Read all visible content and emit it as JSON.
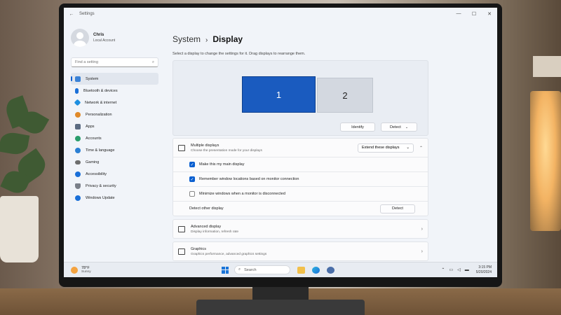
{
  "window": {
    "title": "Settings"
  },
  "user": {
    "name": "Chris",
    "account": "Local Account"
  },
  "search": {
    "placeholder": "Find a setting"
  },
  "sidebar": {
    "items": [
      {
        "label": "System",
        "icon": "monitor-icon",
        "color": "#3b82d6",
        "active": true
      },
      {
        "label": "Bluetooth & devices",
        "icon": "bluetooth-icon",
        "color": "#1a6fd8"
      },
      {
        "label": "Network & internet",
        "icon": "wifi-icon",
        "color": "#1d8fe0"
      },
      {
        "label": "Personalization",
        "icon": "brush-icon",
        "color": "#e08a2a"
      },
      {
        "label": "Apps",
        "icon": "apps-icon",
        "color": "#5b6b82"
      },
      {
        "label": "Accounts",
        "icon": "person-icon",
        "color": "#2a9d6c"
      },
      {
        "label": "Time & language",
        "icon": "globe-icon",
        "color": "#2b7fd3"
      },
      {
        "label": "Gaming",
        "icon": "controller-icon",
        "color": "#6d6d6d"
      },
      {
        "label": "Accessibility",
        "icon": "accessibility-icon",
        "color": "#1a6fd8"
      },
      {
        "label": "Privacy & security",
        "icon": "shield-icon",
        "color": "#7a7f88"
      },
      {
        "label": "Windows Update",
        "icon": "update-icon",
        "color": "#1a6fd8"
      }
    ]
  },
  "main": {
    "breadcrumb_parent": "System",
    "breadcrumb_current": "Display",
    "hint": "Select a display to change the settings for it. Drag displays to rearrange them.",
    "display1": "1",
    "display2": "2",
    "identify_label": "Identify",
    "detect_label": "Detect",
    "multiple_displays": {
      "title": "Multiple displays",
      "subtitle": "Choose the presentation mode for your displays",
      "mode": "Extend these displays",
      "options": [
        {
          "label": "Make this my main display",
          "checked": true
        },
        {
          "label": "Remember window locations based on monitor connection",
          "checked": true
        },
        {
          "label": "Minimize windows when a monitor is disconnected",
          "checked": false
        }
      ],
      "detect_other_label": "Detect other display",
      "detect_button": "Detect"
    },
    "advanced": {
      "title": "Advanced display",
      "subtitle": "Display information, refresh rate"
    },
    "graphics": {
      "title": "Graphics",
      "subtitle": "Graphics performance, advanced graphics settings"
    }
  },
  "taskbar": {
    "temperature": "78°F",
    "condition": "Sunny",
    "search_placeholder": "Search",
    "time": "3:15 PM",
    "date": "5/20/2024"
  }
}
